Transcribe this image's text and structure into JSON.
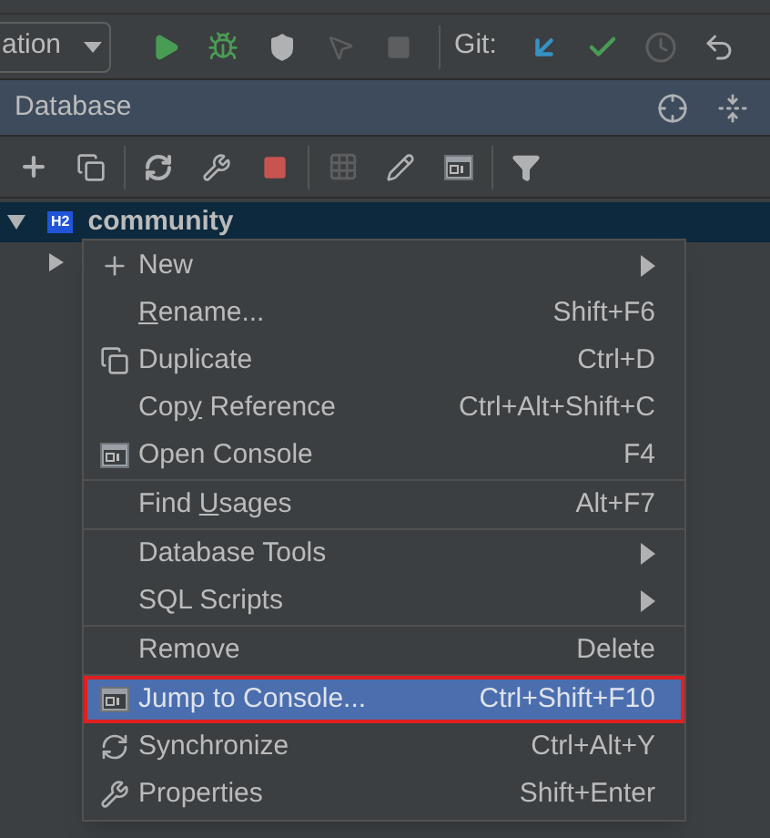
{
  "toolbar": {
    "run_config": "ation",
    "vcs_label": "Git:"
  },
  "panel": {
    "title": "Database"
  },
  "tree": [
    {
      "badge": "H2",
      "name": "community",
      "expanded": true,
      "selected": true,
      "children": [
        {
          "expanded": false
        }
      ]
    }
  ],
  "context_menu": {
    "groups": [
      [
        {
          "label": "New",
          "submenu": true,
          "selected": false
        },
        {
          "mnemonic": "R",
          "label_rest": "ename...",
          "shortcut": "Shift+F6",
          "submenu": false,
          "selected": false
        },
        {
          "label": "Duplicate",
          "shortcut": "Ctrl+D",
          "submenu": false,
          "selected": false
        },
        {
          "label": "Cop",
          "mnemonic": "y",
          "label_rest": " Reference",
          "shortcut": "Ctrl+Alt+Shift+C",
          "submenu": false,
          "selected": false
        },
        {
          "label": "Open Console",
          "shortcut": "F4",
          "submenu": false,
          "selected": false
        }
      ],
      [
        {
          "label": "Find ",
          "mnemonic": "U",
          "label_rest": "sages",
          "shortcut": "Alt+F7",
          "submenu": false,
          "selected": false
        }
      ],
      [
        {
          "label": "Database Tools",
          "submenu": true,
          "selected": false
        },
        {
          "label": "SQL Scripts",
          "submenu": true,
          "selected": false
        }
      ],
      [
        {
          "label": "Remove",
          "shortcut": "Delete",
          "submenu": false,
          "selected": false
        }
      ],
      [
        {
          "label": "Jump to Console...",
          "shortcut": "Ctrl+Shift+F10",
          "submenu": false,
          "selected": true
        },
        {
          "label": "Synchronize",
          "shortcut": "Ctrl+Alt+Y",
          "submenu": false,
          "selected": false
        },
        {
          "label": "Properties",
          "shortcut": "Shift+Enter",
          "submenu": false,
          "selected": false
        }
      ]
    ]
  }
}
